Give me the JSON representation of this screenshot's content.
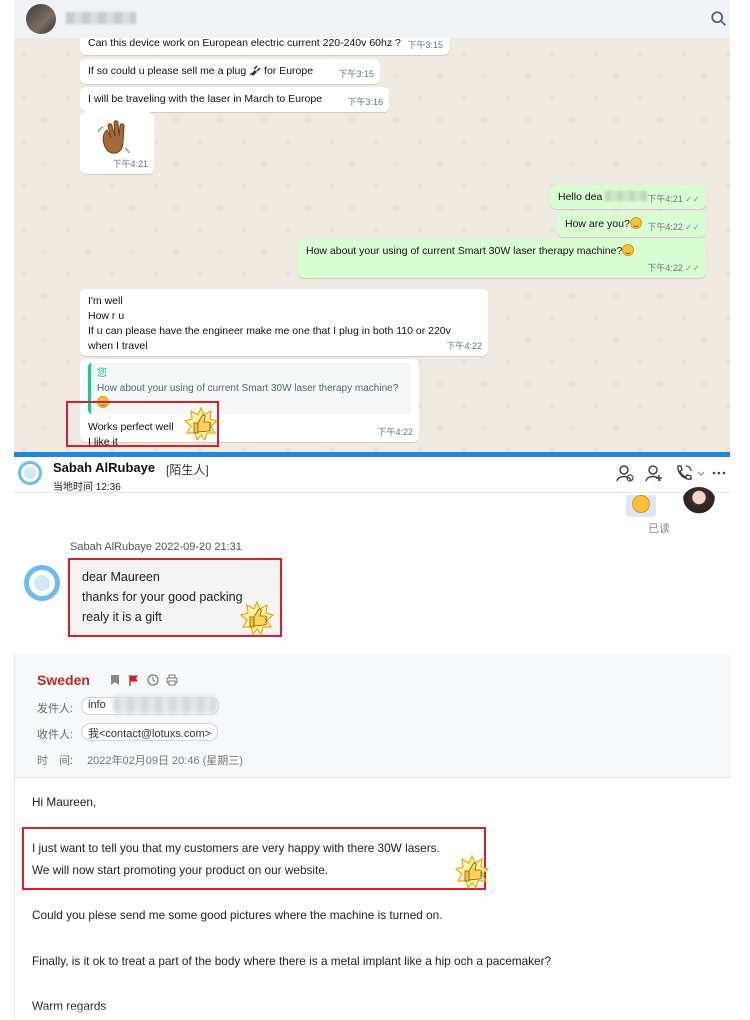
{
  "whatsapp": {
    "incoming_top": [
      {
        "text": "Can this device work on European electric current 220-240v 60hz ?",
        "time": "下午3:15"
      },
      {
        "text_before": "If so could u please sell me a plug",
        "text_after": "for Europe",
        "time": "下午3:15"
      },
      {
        "text": "I will be traveling with the laser in March to Europe",
        "time": "下午3:16"
      },
      {
        "time": "下午4:21"
      }
    ],
    "outgoing": [
      {
        "text": "Hello dea",
        "time": "下午4:21",
        "ticks": "✓✓"
      },
      {
        "text": "How are you?",
        "time": "下午4:22",
        "ticks": "✓✓"
      },
      {
        "text": "How about your using of current Smart 30W laser therapy machine?",
        "time": "下午4:22",
        "ticks": "✓✓"
      }
    ],
    "incoming_reply": {
      "lines": "I'm well\nHow r u\nIf u can please have the engineer make me one that I plug in both 110 or 220v\nwhen I travel",
      "time": "下午4:22"
    },
    "quoted_reply": {
      "quote_author": "您",
      "quote_text": "How about your using of current Smart 30W laser therapy machine?",
      "lines": "Works perfect well\nI like it",
      "time": "下午4:22"
    }
  },
  "qq_chat": {
    "contact_name": "Sabah AlRubaye",
    "tag": "[陌生人]",
    "local_time": "当地时间 12:36",
    "read_status": "已读",
    "sender_line": "Sabah AlRubaye   2022-09-20 21:31",
    "message_lines": [
      "dear Maureen",
      "thanks for your good packing",
      "realy it is a gift"
    ]
  },
  "email": {
    "subject": "Sweden",
    "from_label": "发件人:",
    "from_value": "info",
    "to_label": "收件人:",
    "to_value": "我<contact@lotuxs.com>",
    "time_label": "时　间:",
    "time_value": "2022年02月09日 20:46 (星期三)",
    "body": {
      "greeting": "Hi Maureen,",
      "line1": "I just want to tell you that my customers are very happy with there 30W lasers.",
      "line2": "We will now start promoting your product on our website.",
      "line3": "Could you plese send me some good pictures where the machine is turned on.",
      "line4": "Finally, is it ok to treat a part of the body where there is a metal implant like a hip och a pacemaker?",
      "closing": "Warm regards"
    }
  },
  "colors": {
    "highlight_box": "#d92027",
    "wa_outgoing": "#d9fdd3",
    "divider_blue": "#1f88e5",
    "email_subject": "#c0272d"
  }
}
